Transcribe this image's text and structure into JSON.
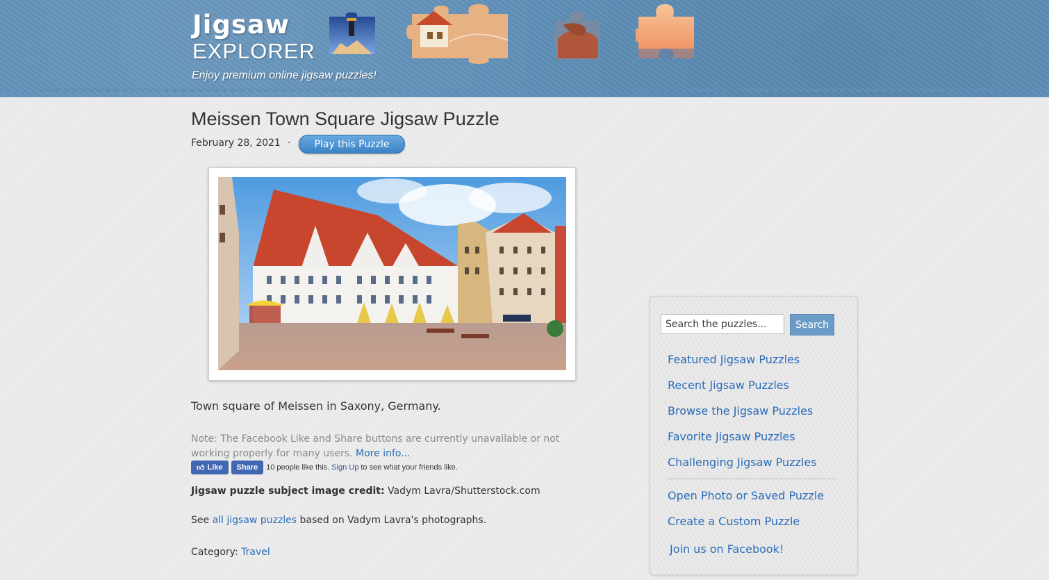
{
  "header": {
    "logo_title": "Jigsaw",
    "logo_sub": "EXPLORER",
    "tagline": "Enjoy premium online jigsaw puzzles!"
  },
  "main": {
    "title": "Meissen Town Square Jigsaw Puzzle",
    "date": "February 28, 2021",
    "separator": "·",
    "play_label": "Play this Puzzle",
    "description": "Town square of Meissen in Saxony, Germany.",
    "note_text": "Note: The Facebook Like and Share buttons are currently unavailable or not working properly for many users.",
    "note_link": "More info...",
    "fb": {
      "like_label": "Like",
      "share_label": "Share",
      "count_text": "10 people like this.",
      "signup_link": "Sign Up",
      "signup_suffix": "to see what your friends like."
    },
    "credit_label": "Jigsaw puzzle subject image credit:",
    "credit_value": "Vadym Lavra/Shutterstock.com",
    "see_prefix": "See",
    "see_link": "all jigsaw puzzles",
    "see_suffix": "based on Vadym Lavra's photographs.",
    "category_label": "Category:",
    "category_link": "Travel"
  },
  "sidebar": {
    "search_placeholder": "Search the puzzles...",
    "search_button": "Search",
    "links": [
      "Featured Jigsaw Puzzles",
      "Recent Jigsaw Puzzles",
      "Browse the Jigsaw Puzzles",
      "Favorite Jigsaw Puzzles",
      "Challenging Jigsaw Puzzles"
    ],
    "links2": [
      "Open Photo or Saved Puzzle",
      "Create a Custom Puzzle"
    ],
    "facebook_link": "Join us on Facebook!"
  },
  "colors": {
    "header_blue": "#5f8fb8",
    "link_blue": "#2a6cb8",
    "button_blue": "#3b84c8",
    "facebook_blue": "#4267b2"
  }
}
